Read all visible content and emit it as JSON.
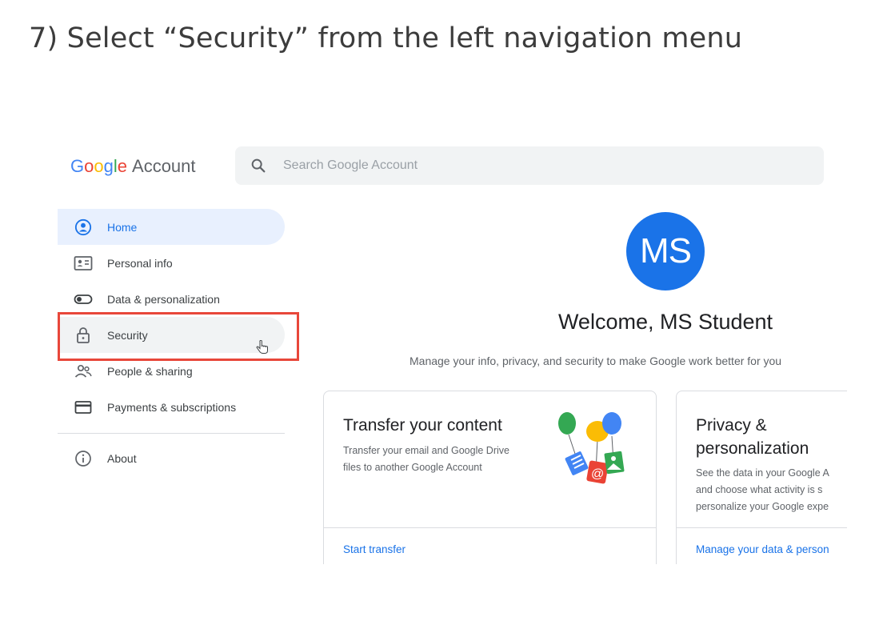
{
  "instruction": "7) Select “Security” from the left navigation menu",
  "header": {
    "logo_letters": [
      "G",
      "o",
      "o",
      "g",
      "l",
      "e"
    ],
    "logo_suffix": "Account",
    "search_placeholder": "Search Google Account"
  },
  "sidebar": {
    "items": [
      {
        "label": "Home",
        "icon": "person-circle-icon"
      },
      {
        "label": "Personal info",
        "icon": "id-card-icon"
      },
      {
        "label": "Data & personalization",
        "icon": "toggle-icon"
      },
      {
        "label": "Security",
        "icon": "lock-icon"
      },
      {
        "label": "People & sharing",
        "icon": "people-icon"
      },
      {
        "label": "Payments & subscriptions",
        "icon": "credit-card-icon"
      }
    ],
    "about": {
      "label": "About",
      "icon": "info-icon"
    }
  },
  "main": {
    "avatar_initials": "MS",
    "welcome": "Welcome, MS Student",
    "subtitle": "Manage your info, privacy, and security to make Google work better for you",
    "cards": [
      {
        "title": "Transfer your content",
        "body_lines": [
          "Transfer your email and Google Drive",
          "files to another Google Account"
        ],
        "link": "Start transfer"
      },
      {
        "title_lines": [
          "Privacy &",
          "personalization"
        ],
        "body_lines": [
          "See the data in your Google A",
          "and choose what activity is s",
          "personalize your Google expe"
        ],
        "link": "Manage your data & person"
      }
    ]
  },
  "colors": {
    "accent": "#1a73e8",
    "highlight_box": "#e8473a",
    "active_nav_bg": "#e8f0fe"
  }
}
